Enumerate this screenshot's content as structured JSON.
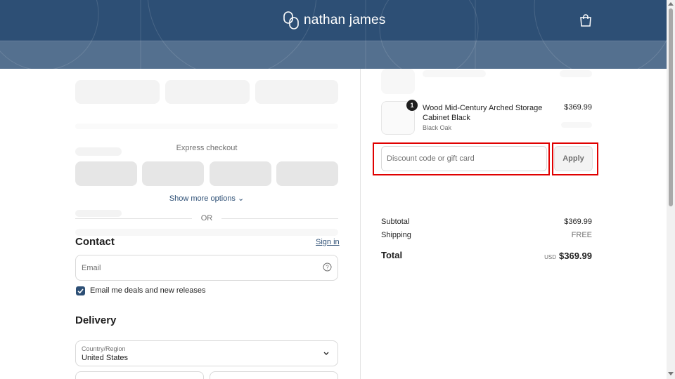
{
  "header": {
    "brand": "nathan james",
    "cart_icon": "shopping-bag-icon"
  },
  "checkout": {
    "express_label": "Express checkout",
    "show_more": "Show more options",
    "or": "OR",
    "contact_title": "Contact",
    "sign_in": "Sign in",
    "email_placeholder": "Email",
    "email_opt_in": "Email me deals and new releases",
    "email_opt_in_checked": true,
    "delivery_title": "Delivery",
    "country_label": "Country/Region",
    "country_value": "United States"
  },
  "order": {
    "item": {
      "quantity": "1",
      "name": "Wood Mid-Century Arched Storage Cabinet Black",
      "variant": "Black Oak",
      "price": "$369.99"
    },
    "discount_placeholder": "Discount code or gift card",
    "apply_label": "Apply",
    "subtotal_label": "Subtotal",
    "subtotal_value": "$369.99",
    "shipping_label": "Shipping",
    "shipping_value": "FREE",
    "total_label": "Total",
    "currency": "USD",
    "total_value": "$369.99"
  },
  "colors": {
    "brand": "#2d4f75",
    "highlight": "#e00000"
  }
}
